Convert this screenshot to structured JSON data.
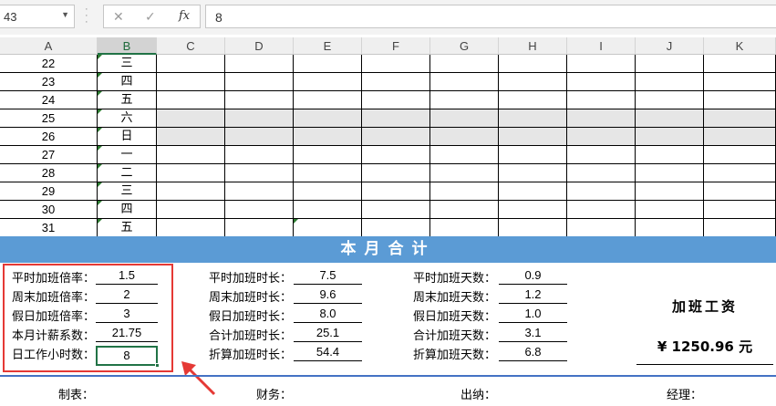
{
  "formula_bar": {
    "name_box": "43",
    "cancel_icon": "✕",
    "enter_icon": "✓",
    "fx_label": "fx",
    "formula_value": "8"
  },
  "columns": [
    "A",
    "B",
    "C",
    "D",
    "E",
    "F",
    "G",
    "H",
    "I",
    "J",
    "K"
  ],
  "active_column": "B",
  "rows": [
    {
      "day": "22",
      "weekday": "三",
      "weekend": false
    },
    {
      "day": "23",
      "weekday": "四",
      "weekend": false
    },
    {
      "day": "24",
      "weekday": "五",
      "weekend": false
    },
    {
      "day": "25",
      "weekday": "六",
      "weekend": true
    },
    {
      "day": "26",
      "weekday": "日",
      "weekend": true
    },
    {
      "day": "27",
      "weekday": "一",
      "weekend": false
    },
    {
      "day": "28",
      "weekday": "二",
      "weekend": false
    },
    {
      "day": "29",
      "weekday": "三",
      "weekend": false
    },
    {
      "day": "30",
      "weekday": "四",
      "weekend": false
    },
    {
      "day": "31",
      "weekday": "五",
      "weekend": false
    }
  ],
  "banner": "本月合计",
  "params": [
    {
      "label": "平时加班倍率：",
      "value": "1.5"
    },
    {
      "label": "周末加班倍率：",
      "value": "2"
    },
    {
      "label": "假日加班倍率：",
      "value": "3"
    },
    {
      "label": "本月计薪系数：",
      "value": "21.75"
    },
    {
      "label": "日工作小时数：",
      "value": "8"
    }
  ],
  "hours": [
    {
      "label": "平时加班时长：",
      "value": "7.5"
    },
    {
      "label": "周末加班时长：",
      "value": "9.6"
    },
    {
      "label": "假日加班时长：",
      "value": "8.0"
    },
    {
      "label": "合计加班时长：",
      "value": "25.1"
    },
    {
      "label": "折算加班时长：",
      "value": "54.4"
    }
  ],
  "days": [
    {
      "label": "平时加班天数：",
      "value": "0.9"
    },
    {
      "label": "周末加班天数：",
      "value": "1.2"
    },
    {
      "label": "假日加班天数：",
      "value": "1.0"
    },
    {
      "label": "合计加班天数：",
      "value": "3.1"
    },
    {
      "label": "折算加班天数：",
      "value": "6.8"
    }
  ],
  "wage": {
    "title": "加班工资",
    "amount": "¥ 1250.96 元"
  },
  "footer": {
    "maker": "制表：",
    "finance": "财务：",
    "cashier": "出纳：",
    "manager": "经理："
  },
  "colors": {
    "banner": "#5b9bd5",
    "highlight_box": "#e53935",
    "selection": "#217346",
    "weekend_shade": "#e6e6e6"
  }
}
